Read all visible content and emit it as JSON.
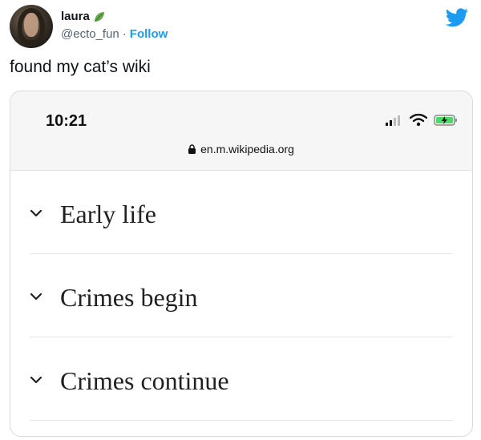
{
  "tweet": {
    "display_name": "laura",
    "handle": "@ecto_fun",
    "separator": "·",
    "follow_label": "Follow",
    "text": "found my cat’s wiki"
  },
  "icons": {
    "avatar": "avatar",
    "leaf": "leaf-icon",
    "bird": "twitter-bird-icon",
    "signal": "signal-icon",
    "wifi": "wifi-icon",
    "battery": "battery-charging-icon",
    "lock": "lock-icon",
    "chevron": "chevron-down-icon"
  },
  "phone": {
    "time": "10:21",
    "url": "en.m.wikipedia.org",
    "sections": [
      {
        "title": "Early life"
      },
      {
        "title": "Crimes begin"
      },
      {
        "title": "Crimes continue"
      }
    ]
  },
  "colors": {
    "twitter_blue": "#1d9bf0",
    "leaf_green": "#6aa84f",
    "battery_green": "#4cd964"
  }
}
